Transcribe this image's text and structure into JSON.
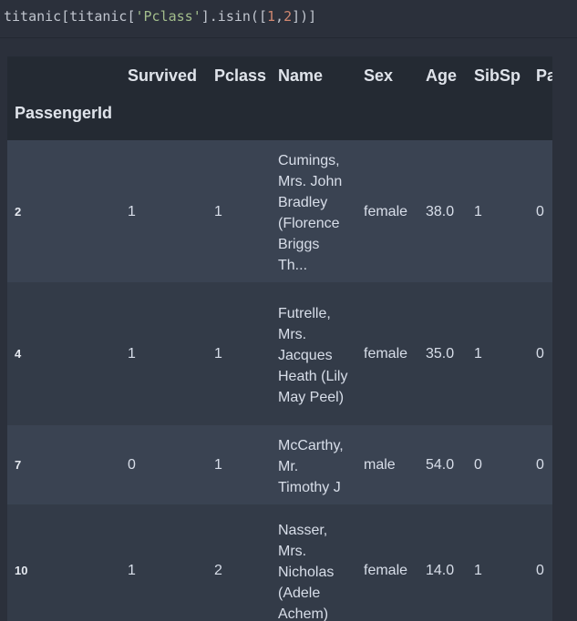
{
  "code": {
    "prefix": "titanic[titanic[",
    "string": "'Pclass'",
    "middle": "].isin([",
    "num1": "1",
    "comma": ",",
    "num2": "2",
    "suffix": "])]"
  },
  "table": {
    "columns": [
      "Survived",
      "Pclass",
      "Name",
      "Sex",
      "Age",
      "SibSp",
      "Pa"
    ],
    "index_name": "PassengerId",
    "rows": [
      {
        "id": "2",
        "survived": "1",
        "pclass": "1",
        "name": "Cumings, Mrs. John Bradley (Florence Briggs Th...",
        "sex": "female",
        "age": "38.0",
        "sibsp": "1",
        "parch": "0"
      },
      {
        "id": "4",
        "survived": "1",
        "pclass": "1",
        "name": "Futrelle, Mrs. Jacques Heath (Lily May Peel)",
        "sex": "female",
        "age": "35.0",
        "sibsp": "1",
        "parch": "0"
      },
      {
        "id": "7",
        "survived": "0",
        "pclass": "1",
        "name": "McCarthy, Mr. Timothy J",
        "sex": "male",
        "age": "54.0",
        "sibsp": "0",
        "parch": "0"
      },
      {
        "id": "10",
        "survived": "1",
        "pclass": "2",
        "name": "Nasser, Mrs. Nicholas (Adele Achem)",
        "sex": "female",
        "age": "14.0",
        "sibsp": "1",
        "parch": "0"
      }
    ]
  },
  "colors": {
    "background": "#2b303b",
    "header": "#242a33",
    "row_odd": "#3a4352",
    "row_even": "#333b48",
    "string_token": "#a3be8c",
    "number_token": "#d08770"
  }
}
